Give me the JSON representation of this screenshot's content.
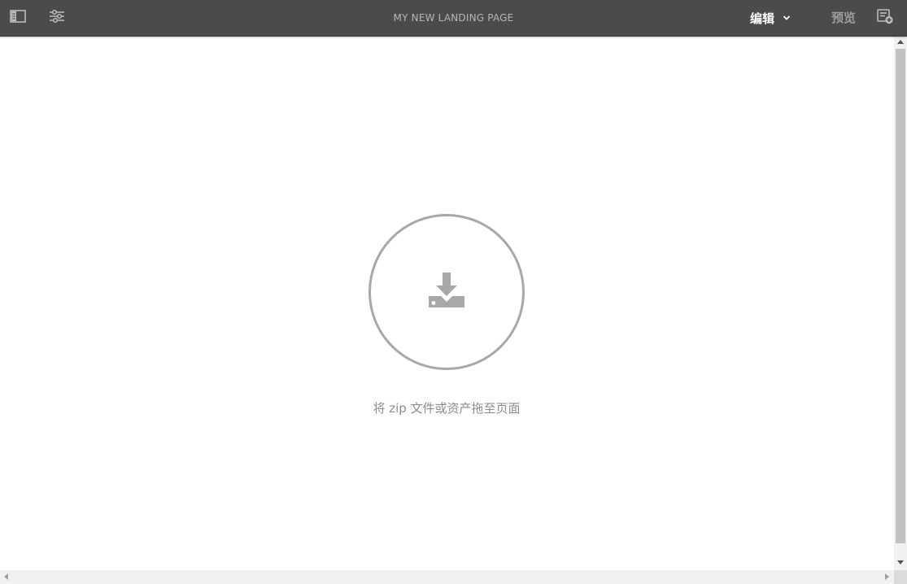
{
  "toolbar": {
    "page_title": "MY NEW LANDING PAGE",
    "mode_label": "编辑",
    "preview_label": "预览",
    "icons": {
      "side_panel": "side-panel-toggle-icon",
      "properties": "page-properties-icon",
      "mode_dropdown": "chevron-down-icon",
      "annotate": "annotations-icon"
    }
  },
  "canvas": {
    "drop_icon": "download-tray-icon",
    "drop_text": "将 zip 文件或资产拖至页面"
  },
  "colors": {
    "toolbar_bg": "#4b4b4b",
    "title_text": "#b5b5b5",
    "drop_circle": "#a8a8a8",
    "drop_text": "#8c8c8c"
  }
}
